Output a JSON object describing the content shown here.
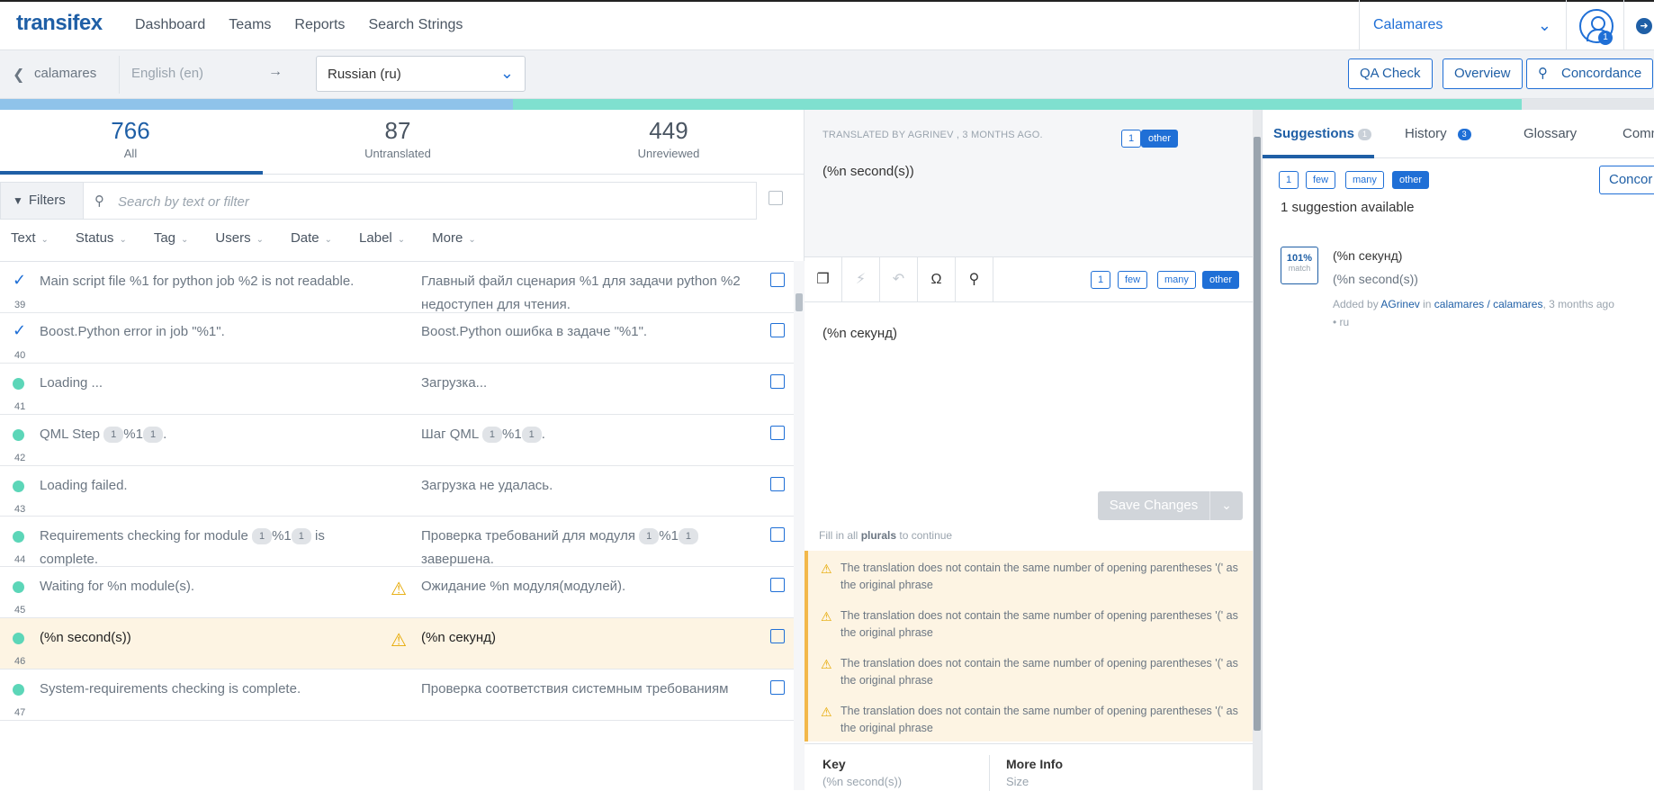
{
  "header": {
    "logo": "transifex",
    "nav": [
      "Dashboard",
      "Teams",
      "Reports",
      "Search Strings"
    ],
    "project_select": "Calamares",
    "avatar_badge": "1"
  },
  "subbar": {
    "back_label": "calamares",
    "source_language": "English (en)",
    "arrow": "→",
    "target_language": "Russian (ru)",
    "qa_check": "QA Check",
    "overview": "Overview",
    "concordance": "Concordance"
  },
  "progress": {
    "reviewed_pct": 31,
    "translated_pct": 61
  },
  "stats": [
    {
      "number": "766",
      "label": "All"
    },
    {
      "number": "87",
      "label": "Untranslated"
    },
    {
      "number": "449",
      "label": "Unreviewed"
    }
  ],
  "filters": {
    "button": "Filters",
    "search_placeholder": "Search by text or filter",
    "dropdowns": [
      "Text",
      "Status",
      "Tag",
      "Users",
      "Date",
      "Label",
      "More"
    ]
  },
  "rows": [
    {
      "idx": "39",
      "status": "reviewed",
      "src": "Main script file %1 for python job %2 is not readable.",
      "tgt": "Главный файл сценария %1 для задачи python %2 недоступен для чтения.",
      "warn": false,
      "selected": false
    },
    {
      "idx": "40",
      "status": "reviewed",
      "src": "Boost.Python error in job \"%1\".",
      "tgt": "Boost.Python ошибка в задаче \"%1\".",
      "warn": false,
      "selected": false
    },
    {
      "idx": "41",
      "status": "translated",
      "src": "Loading ...",
      "tgt": "Загрузка...",
      "warn": false,
      "selected": false
    },
    {
      "idx": "42",
      "status": "translated",
      "src_parts": [
        "QML Step ",
        "1",
        "%1",
        "1",
        "."
      ],
      "tgt_parts": [
        "Шаг QML ",
        "1",
        "%1",
        "1",
        "."
      ],
      "warn": false,
      "selected": false
    },
    {
      "idx": "43",
      "status": "translated",
      "src": "Loading failed.",
      "tgt": "Загрузка не удалась.",
      "warn": false,
      "selected": false
    },
    {
      "idx": "44",
      "status": "translated",
      "src_parts": [
        "Requirements checking for module ",
        "1",
        "%1",
        "1",
        " is complete."
      ],
      "tgt_parts": [
        "Проверка требований для модуля ",
        "1",
        "%1",
        "1",
        " завершена."
      ],
      "warn": false,
      "selected": false
    },
    {
      "idx": "45",
      "status": "translated",
      "src": "Waiting for %n module(s).",
      "tgt": "Ожидание %n модуля(модулей).",
      "warn": true,
      "selected": false
    },
    {
      "idx": "46",
      "status": "translated",
      "src": "(%n second(s))",
      "tgt": "(%n секунд)",
      "warn": true,
      "selected": true
    },
    {
      "idx": "47",
      "status": "translated",
      "src": "System-requirements checking is complete.",
      "tgt": "Проверка соответствия системным требованиям",
      "warn": false,
      "selected": false
    }
  ],
  "editor": {
    "meta": "TRANSLATED BY AGRINEV , 3 MONTHS AGO.",
    "source_forms": [
      "1",
      "other"
    ],
    "source_text": "(%n second(s))",
    "target_forms": [
      "1",
      "few",
      "many",
      "other"
    ],
    "target_text": "(%n секунд)",
    "save_label": "Save Changes",
    "hint_prefix": "Fill in all ",
    "hint_bold": "plurals",
    "hint_suffix": " to continue",
    "warnings": [
      "The translation does not contain the same number of opening parentheses '(' as the original phrase",
      "The translation does not contain the same number of opening parentheses '(' as the original phrase",
      "The translation does not contain the same number of opening parentheses '(' as the original phrase",
      "The translation does not contain the same number of opening parentheses '(' as the original phrase"
    ],
    "key_label": "Key",
    "key_value": "(%n second(s))",
    "more_info_label": "More Info",
    "more_info_value": "Size"
  },
  "right": {
    "tabs": [
      {
        "label": "Suggestions",
        "badge": "1"
      },
      {
        "label": "History",
        "badge": "3"
      },
      {
        "label": "Glossary",
        "badge": ""
      },
      {
        "label": "Comm",
        "badge": ""
      }
    ],
    "forms": [
      "1",
      "few",
      "many",
      "other"
    ],
    "concordance_btn": "Concor",
    "count_text": "1 suggestion available",
    "suggestion": {
      "match_pct": "101%",
      "match_label": "match",
      "translation": "(%n секунд)",
      "source": "(%n second(s))",
      "added_by_prefix": "Added by ",
      "user": "AGrinev",
      "in_text": " in ",
      "project": "calamares / calamares",
      "time": ", 3 months ago",
      "lang": "• ru"
    }
  },
  "colors": {
    "brand": "#1f5fa6",
    "accent": "#1f6fd6",
    "warning": "#e6a800",
    "translated_dot": "#5cd6b8"
  }
}
